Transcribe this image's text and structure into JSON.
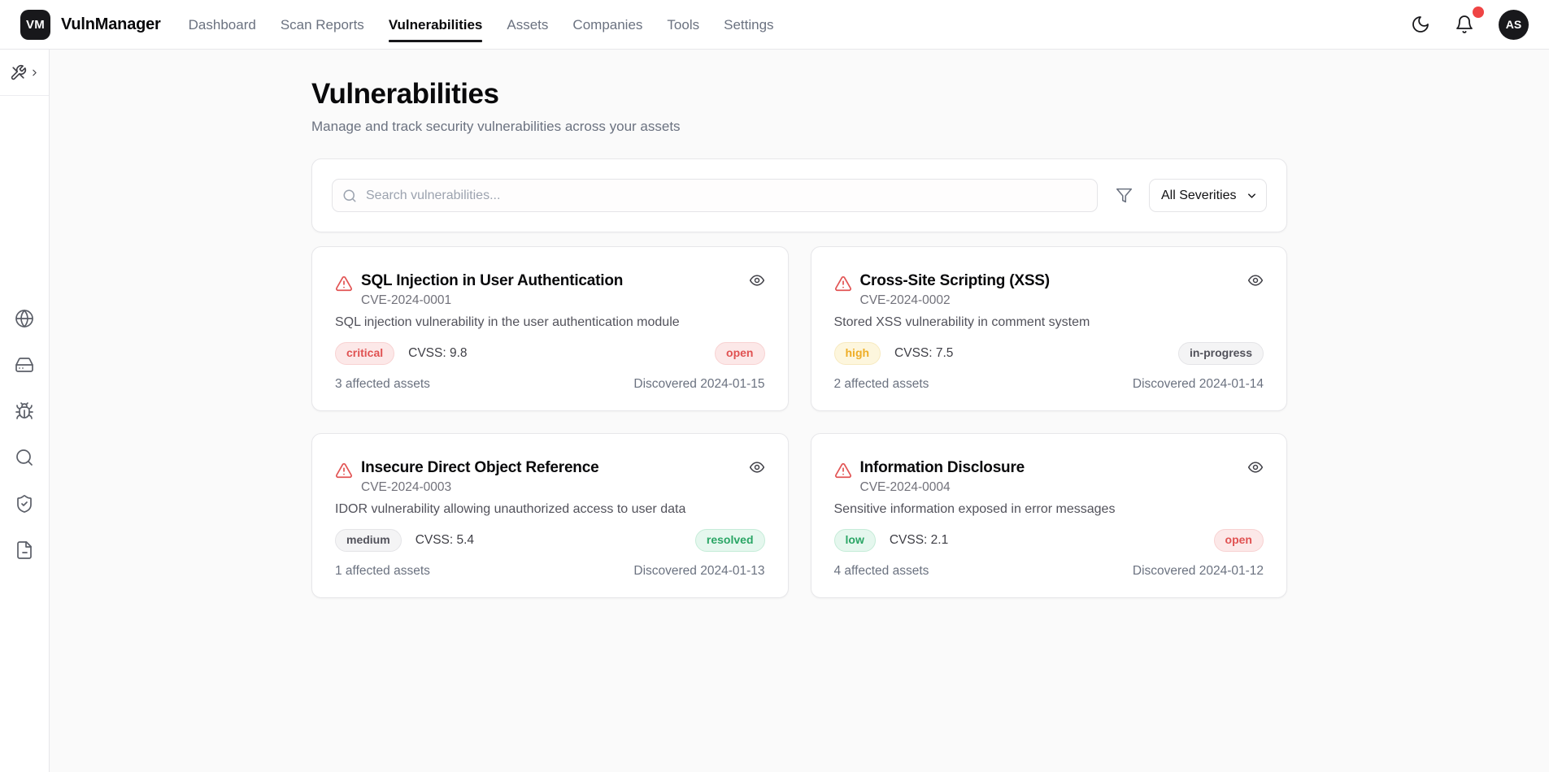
{
  "brand": {
    "logo": "VM",
    "name": "VulnManager"
  },
  "topnav": {
    "items": [
      {
        "label": "Dashboard",
        "active": false
      },
      {
        "label": "Scan Reports",
        "active": false
      },
      {
        "label": "Vulnerabilities",
        "active": true
      },
      {
        "label": "Assets",
        "active": false
      },
      {
        "label": "Companies",
        "active": false
      },
      {
        "label": "Tools",
        "active": false
      },
      {
        "label": "Settings",
        "active": false
      }
    ]
  },
  "topbar": {
    "avatar": "AS",
    "icons": [
      "moon-icon",
      "bell-icon"
    ],
    "notification_dot": true
  },
  "sidebar": {
    "icons": [
      "tools-icon",
      "chevron-right-icon",
      "globe-icon",
      "hard-drive-icon",
      "bug-icon",
      "search-icon",
      "shield-check-icon",
      "file-text-icon"
    ]
  },
  "page": {
    "title": "Vulnerabilities",
    "subtitle": "Manage and track security vulnerabilities across your assets"
  },
  "filters": {
    "search_placeholder": "Search vulnerabilities...",
    "severity_selected": "All Severities"
  },
  "vulnerabilities": [
    {
      "title": "SQL Injection in User Authentication",
      "cve": "CVE-2024-0001",
      "description": "SQL injection vulnerability in the user authentication module",
      "severity": "critical",
      "cvss": "CVSS: 9.8",
      "status": "open",
      "affected": "3 affected assets",
      "discovered": "Discovered 2024-01-15"
    },
    {
      "title": "Cross-Site Scripting (XSS)",
      "cve": "CVE-2024-0002",
      "description": "Stored XSS vulnerability in comment system",
      "severity": "high",
      "cvss": "CVSS: 7.5",
      "status": "in-progress",
      "affected": "2 affected assets",
      "discovered": "Discovered 2024-01-14"
    },
    {
      "title": "Insecure Direct Object Reference",
      "cve": "CVE-2024-0003",
      "description": "IDOR vulnerability allowing unauthorized access to user data",
      "severity": "medium",
      "cvss": "CVSS: 5.4",
      "status": "resolved",
      "affected": "1 affected assets",
      "discovered": "Discovered 2024-01-13"
    },
    {
      "title": "Information Disclosure",
      "cve": "CVE-2024-0004",
      "description": "Sensitive information exposed in error messages",
      "severity": "low",
      "cvss": "CVSS: 2.1",
      "status": "open",
      "affected": "4 affected assets",
      "discovered": "Discovered 2024-01-12"
    }
  ],
  "colors": {
    "severity_critical": "#e05252",
    "severity_high": "#eead26",
    "severity_medium": "#52525b",
    "severity_low": "#2aa565",
    "status_open": "#e05252",
    "status_in_progress": "#52525b",
    "status_resolved": "#2aa565",
    "notification_badge": "#ef4444",
    "active_nav_underline": "#18181b"
  }
}
